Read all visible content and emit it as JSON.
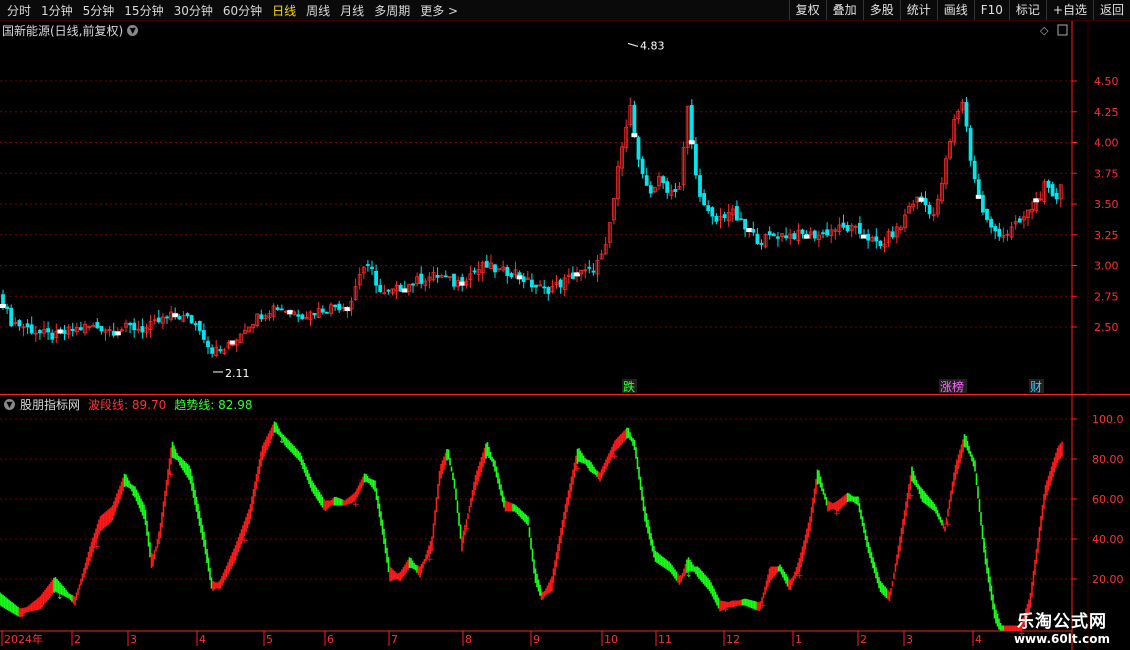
{
  "toolbar": {
    "periods": [
      {
        "label": "分时"
      },
      {
        "label": "1分钟"
      },
      {
        "label": "5分钟"
      },
      {
        "label": "15分钟"
      },
      {
        "label": "30分钟"
      },
      {
        "label": "60分钟"
      },
      {
        "label": "日线",
        "active": true
      },
      {
        "label": "周线"
      },
      {
        "label": "月线"
      },
      {
        "label": "多周期"
      },
      {
        "label": "更多 >"
      }
    ],
    "tools": [
      "复权",
      "叠加",
      "多股",
      "统计",
      "画线",
      "F10",
      "标记",
      "+自选",
      "返回"
    ]
  },
  "main_chart": {
    "title": "国新能源(日线,前复权)",
    "price_labels": [
      "4.50",
      "4.25",
      "4.00",
      "3.75",
      "3.50",
      "3.25",
      "3.00",
      "2.75",
      "2.50"
    ],
    "max_price_label": "4.83",
    "min_price_label": "2.11",
    "markers": [
      {
        "text": "跌",
        "color": "#33ff33"
      },
      {
        "text": "涨榜",
        "color": "#ff66ff"
      },
      {
        "text": "财",
        "color": "#33ccff"
      }
    ]
  },
  "indicator": {
    "name": "股朋指标网",
    "wave_label": "波段线:",
    "wave_value": "89.70",
    "trend_label": "趋势线:",
    "trend_value": "82.98",
    "axis_labels": [
      "100.0",
      "80.00",
      "60.00",
      "40.00",
      "20.00"
    ]
  },
  "time_axis": [
    "2024年",
    "2",
    "3",
    "4",
    "5",
    "6",
    "7",
    "8",
    "9",
    "10",
    "11",
    "12",
    "1",
    "2",
    "3",
    "4"
  ],
  "watermark": {
    "line1": "乐淘公式网",
    "line2": "www.60lt.com"
  },
  "colors": {
    "up": "#ff2a2a",
    "down": "#00e5ee",
    "ind_up": "#ff1a1a",
    "ind_down": "#18ff18",
    "grid": "#7a0000",
    "axis": "#ff2020",
    "bg": "#000000"
  },
  "chart_data": [
    {
      "type": "candlestick",
      "title": "国新能源(日线,前复权)",
      "ylim": [
        2.0,
        4.9
      ],
      "yticks": [
        2.5,
        2.75,
        3.0,
        3.25,
        3.5,
        3.75,
        4.0,
        4.25,
        4.5
      ],
      "close_path": [
        [
          0,
          2.78
        ],
        [
          10,
          2.55
        ],
        [
          25,
          2.5
        ],
        [
          40,
          2.45
        ],
        [
          55,
          2.42
        ],
        [
          70,
          2.47
        ],
        [
          85,
          2.5
        ],
        [
          100,
          2.5
        ],
        [
          115,
          2.47
        ],
        [
          130,
          2.5
        ],
        [
          145,
          2.48
        ],
        [
          160,
          2.55
        ],
        [
          175,
          2.6
        ],
        [
          190,
          2.56
        ],
        [
          200,
          2.5
        ],
        [
          210,
          2.32
        ],
        [
          220,
          2.3
        ],
        [
          230,
          2.35
        ],
        [
          245,
          2.5
        ],
        [
          260,
          2.6
        ],
        [
          275,
          2.67
        ],
        [
          290,
          2.63
        ],
        [
          305,
          2.6
        ],
        [
          320,
          2.64
        ],
        [
          335,
          2.67
        ],
        [
          350,
          2.68
        ],
        [
          362,
          3.0
        ],
        [
          372,
          2.95
        ],
        [
          382,
          2.75
        ],
        [
          395,
          2.8
        ],
        [
          410,
          2.85
        ],
        [
          425,
          2.9
        ],
        [
          440,
          2.92
        ],
        [
          455,
          2.85
        ],
        [
          470,
          2.93
        ],
        [
          485,
          3.0
        ],
        [
          500,
          2.95
        ],
        [
          515,
          2.95
        ],
        [
          530,
          2.85
        ],
        [
          545,
          2.8
        ],
        [
          560,
          2.85
        ],
        [
          575,
          2.93
        ],
        [
          590,
          2.95
        ],
        [
          605,
          3.1
        ],
        [
          615,
          3.6
        ],
        [
          622,
          4.0
        ],
        [
          630,
          4.3
        ],
        [
          640,
          3.75
        ],
        [
          650,
          3.6
        ],
        [
          660,
          3.7
        ],
        [
          670,
          3.6
        ],
        [
          680,
          3.65
        ],
        [
          688,
          4.3
        ],
        [
          695,
          3.75
        ],
        [
          705,
          3.45
        ],
        [
          715,
          3.35
        ],
        [
          730,
          3.45
        ],
        [
          745,
          3.3
        ],
        [
          760,
          3.2
        ],
        [
          775,
          3.25
        ],
        [
          790,
          3.25
        ],
        [
          805,
          3.25
        ],
        [
          820,
          3.25
        ],
        [
          835,
          3.3
        ],
        [
          850,
          3.3
        ],
        [
          865,
          3.25
        ],
        [
          880,
          3.15
        ],
        [
          890,
          3.25
        ],
        [
          900,
          3.3
        ],
        [
          910,
          3.5
        ],
        [
          920,
          3.55
        ],
        [
          935,
          3.4
        ],
        [
          945,
          3.8
        ],
        [
          955,
          4.2
        ],
        [
          963,
          4.35
        ],
        [
          970,
          3.9
        ],
        [
          980,
          3.5
        ],
        [
          990,
          3.3
        ],
        [
          1005,
          3.25
        ],
        [
          1020,
          3.35
        ],
        [
          1035,
          3.5
        ],
        [
          1045,
          3.65
        ],
        [
          1055,
          3.5
        ],
        [
          1063,
          3.75
        ]
      ],
      "max": {
        "x": 628,
        "price": 4.83
      },
      "min": {
        "x": 213,
        "price": 2.11
      }
    },
    {
      "type": "area",
      "title": "股朋指标网",
      "ylim": [
        0,
        100
      ],
      "yticks": [
        20,
        40,
        60,
        80,
        100
      ],
      "series": [
        {
          "name": "波段线",
          "last": 89.7,
          "points": [
            [
              0,
              8
            ],
            [
              20,
              2
            ],
            [
              40,
              10
            ],
            [
              55,
              20
            ],
            [
              75,
              8
            ],
            [
              90,
              35
            ],
            [
              100,
              50
            ],
            [
              112,
              55
            ],
            [
              125,
              72
            ],
            [
              135,
              62
            ],
            [
              145,
              50
            ],
            [
              152,
              25
            ],
            [
              160,
              45
            ],
            [
              172,
              88
            ],
            [
              180,
              78
            ],
            [
              190,
              70
            ],
            [
              205,
              35
            ],
            [
              212,
              15
            ],
            [
              220,
              18
            ],
            [
              235,
              35
            ],
            [
              250,
              55
            ],
            [
              262,
              85
            ],
            [
              275,
              98
            ],
            [
              285,
              88
            ],
            [
              300,
              80
            ],
            [
              312,
              65
            ],
            [
              325,
              55
            ],
            [
              335,
              60
            ],
            [
              345,
              58
            ],
            [
              355,
              62
            ],
            [
              365,
              72
            ],
            [
              375,
              65
            ],
            [
              382,
              45
            ],
            [
              390,
              20
            ],
            [
              400,
              22
            ],
            [
              410,
              30
            ],
            [
              420,
              22
            ],
            [
              432,
              40
            ],
            [
              440,
              75
            ],
            [
              448,
              85
            ],
            [
              455,
              65
            ],
            [
              462,
              35
            ],
            [
              475,
              70
            ],
            [
              487,
              88
            ],
            [
              495,
              75
            ],
            [
              505,
              55
            ],
            [
              515,
              55
            ],
            [
              528,
              48
            ],
            [
              535,
              20
            ],
            [
              542,
              10
            ],
            [
              552,
              20
            ],
            [
              565,
              55
            ],
            [
              578,
              85
            ],
            [
              590,
              75
            ],
            [
              600,
              72
            ],
            [
              615,
              88
            ],
            [
              628,
              95
            ],
            [
              635,
              85
            ],
            [
              645,
              50
            ],
            [
              655,
              30
            ],
            [
              670,
              25
            ],
            [
              680,
              18
            ],
            [
              688,
              30
            ],
            [
              698,
              22
            ],
            [
              710,
              15
            ],
            [
              720,
              5
            ],
            [
              732,
              8
            ],
            [
              745,
              8
            ],
            [
              760,
              5
            ],
            [
              770,
              25
            ],
            [
              780,
              25
            ],
            [
              790,
              15
            ],
            [
              800,
              30
            ],
            [
              810,
              50
            ],
            [
              818,
              75
            ],
            [
              828,
              55
            ],
            [
              838,
              58
            ],
            [
              848,
              62
            ],
            [
              858,
              58
            ],
            [
              868,
              35
            ],
            [
              880,
              15
            ],
            [
              890,
              10
            ],
            [
              900,
              40
            ],
            [
              912,
              75
            ],
            [
              922,
              60
            ],
            [
              935,
              55
            ],
            [
              945,
              45
            ],
            [
              955,
              75
            ],
            [
              965,
              92
            ],
            [
              975,
              75
            ],
            [
              985,
              30
            ],
            [
              995,
              0
            ],
            [
              1005,
              -10
            ],
            [
              1018,
              -8
            ],
            [
              1030,
              10
            ],
            [
              1045,
              65
            ],
            [
              1058,
              85
            ],
            [
              1063,
              88
            ]
          ]
        },
        {
          "name": "趋势线",
          "last": 82.98,
          "points": [
            [
              0,
              12
            ],
            [
              20,
              4
            ],
            [
              40,
              6
            ],
            [
              55,
              15
            ],
            [
              75,
              10
            ],
            [
              90,
              30
            ],
            [
              100,
              45
            ],
            [
              112,
              50
            ],
            [
              125,
              68
            ],
            [
              135,
              65
            ],
            [
              145,
              55
            ],
            [
              152,
              30
            ],
            [
              160,
              40
            ],
            [
              172,
              82
            ],
            [
              180,
              80
            ],
            [
              190,
              75
            ],
            [
              205,
              40
            ],
            [
              212,
              18
            ],
            [
              220,
              16
            ],
            [
              235,
              30
            ],
            [
              250,
              50
            ],
            [
              262,
              80
            ],
            [
              275,
              95
            ],
            [
              285,
              90
            ],
            [
              300,
              82
            ],
            [
              312,
              68
            ],
            [
              325,
              58
            ],
            [
              335,
              58
            ],
            [
              345,
              58
            ],
            [
              355,
              60
            ],
            [
              365,
              70
            ],
            [
              375,
              68
            ],
            [
              382,
              50
            ],
            [
              390,
              25
            ],
            [
              400,
              20
            ],
            [
              410,
              27
            ],
            [
              420,
              25
            ],
            [
              432,
              35
            ],
            [
              440,
              70
            ],
            [
              448,
              82
            ],
            [
              455,
              68
            ],
            [
              462,
              40
            ],
            [
              475,
              65
            ],
            [
              487,
              83
            ],
            [
              495,
              78
            ],
            [
              505,
              58
            ],
            [
              515,
              56
            ],
            [
              528,
              50
            ],
            [
              535,
              25
            ],
            [
              542,
              12
            ],
            [
              552,
              15
            ],
            [
              565,
              50
            ],
            [
              578,
              80
            ],
            [
              590,
              78
            ],
            [
              600,
              70
            ],
            [
              615,
              85
            ],
            [
              628,
              92
            ],
            [
              635,
              88
            ],
            [
              645,
              55
            ],
            [
              655,
              33
            ],
            [
              670,
              27
            ],
            [
              680,
              20
            ],
            [
              688,
              25
            ],
            [
              698,
              25
            ],
            [
              710,
              18
            ],
            [
              720,
              8
            ],
            [
              732,
              7
            ],
            [
              745,
              9
            ],
            [
              760,
              7
            ],
            [
              770,
              20
            ],
            [
              780,
              26
            ],
            [
              790,
              18
            ],
            [
              800,
              25
            ],
            [
              810,
              45
            ],
            [
              818,
              70
            ],
            [
              828,
              58
            ],
            [
              838,
              55
            ],
            [
              848,
              60
            ],
            [
              858,
              60
            ],
            [
              868,
              38
            ],
            [
              880,
              18
            ],
            [
              890,
              12
            ],
            [
              900,
              35
            ],
            [
              912,
              70
            ],
            [
              922,
              64
            ],
            [
              935,
              56
            ],
            [
              945,
              45
            ],
            [
              955,
              70
            ],
            [
              965,
              88
            ],
            [
              975,
              78
            ],
            [
              985,
              35
            ],
            [
              995,
              5
            ],
            [
              1005,
              -10
            ],
            [
              1018,
              -10
            ],
            [
              1030,
              5
            ],
            [
              1045,
              60
            ],
            [
              1058,
              80
            ],
            [
              1063,
              83
            ]
          ]
        }
      ]
    }
  ]
}
